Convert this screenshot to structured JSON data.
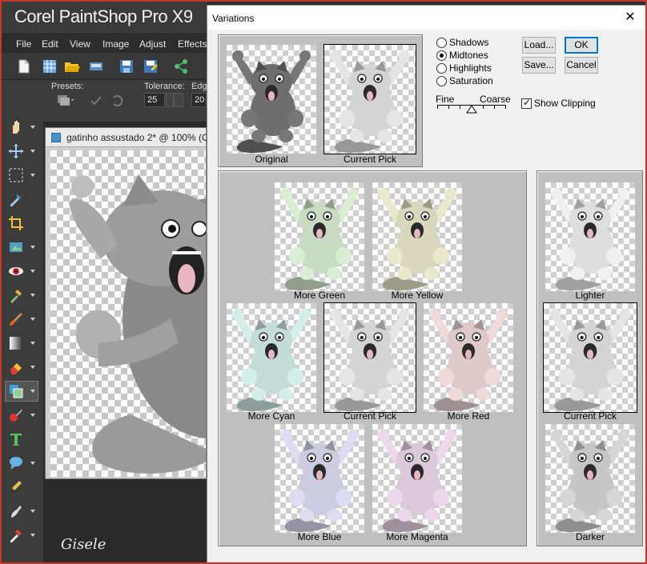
{
  "psp": {
    "app_title": "Corel PaintShop Pro X9",
    "menu": [
      "File",
      "Edit",
      "View",
      "Image",
      "Adjust",
      "Effects"
    ],
    "presets_label": "Presets:",
    "tolerance_label": "Tolerance:",
    "tolerance_value": "25",
    "edge_label": "Edg",
    "edge_value": "20",
    "doc_title": "gatinho assustado 2* @ 100% (Co",
    "signature": "Gisele"
  },
  "dialog": {
    "title": "Variations",
    "close_glyph": "✕",
    "top_thumbs": {
      "original": "Original",
      "current_pick": "Current Pick"
    },
    "radios": [
      {
        "label": "Shadows",
        "selected": false
      },
      {
        "label": "Midtones",
        "selected": true
      },
      {
        "label": "Highlights",
        "selected": false
      },
      {
        "label": "Saturation",
        "selected": false
      }
    ],
    "slider": {
      "fine": "Fine",
      "coarse": "Coarse"
    },
    "buttons": {
      "load": "Load...",
      "ok": "OK",
      "save": "Save...",
      "cancel": "Cancel"
    },
    "show_clipping": {
      "label": "Show Clipping",
      "checked": true
    },
    "variations": {
      "more_green": "More Green",
      "more_yellow": "More Yellow",
      "more_cyan": "More Cyan",
      "current_pick": "Current Pick",
      "more_red": "More Red",
      "more_blue": "More Blue",
      "more_magenta": "More Magenta"
    },
    "brightness": {
      "lighter": "Lighter",
      "current_pick": "Current Pick",
      "darker": "Darker"
    }
  },
  "colors": {
    "dialog_bg": "#f0f0f0",
    "panel_bg": "#bfbfbf",
    "app_dark": "#2f2f2f",
    "accent_ok": "#0078d7",
    "tint_original": "#6e6e6e",
    "tint_current": "#d4d4d4",
    "tint_green": "#c9dcc3",
    "tint_yellow": "#d9d8bd",
    "tint_cyan": "#c4dcd8",
    "tint_red": "#ddc9c9",
    "tint_blue": "#cccce0",
    "tint_magenta": "#dbc8da",
    "tint_lighter": "#dedede",
    "tint_darker": "#c6c6c6"
  },
  "icons": [
    "new-icon",
    "grid-icon",
    "open-icon",
    "scan-icon",
    "save-icon",
    "save-as-icon",
    "share-icon",
    "pan-icon",
    "move-icon",
    "selection-icon",
    "dropper-icon",
    "crop-icon",
    "straighten-icon",
    "red-eye-icon",
    "makeover-icon",
    "brush-icon",
    "gradient-icon",
    "eraser-icon",
    "flood-fill-icon",
    "retouch-icon",
    "text-icon",
    "shape-icon",
    "pen-icon",
    "smudge-icon",
    "eyedropper-icon"
  ]
}
